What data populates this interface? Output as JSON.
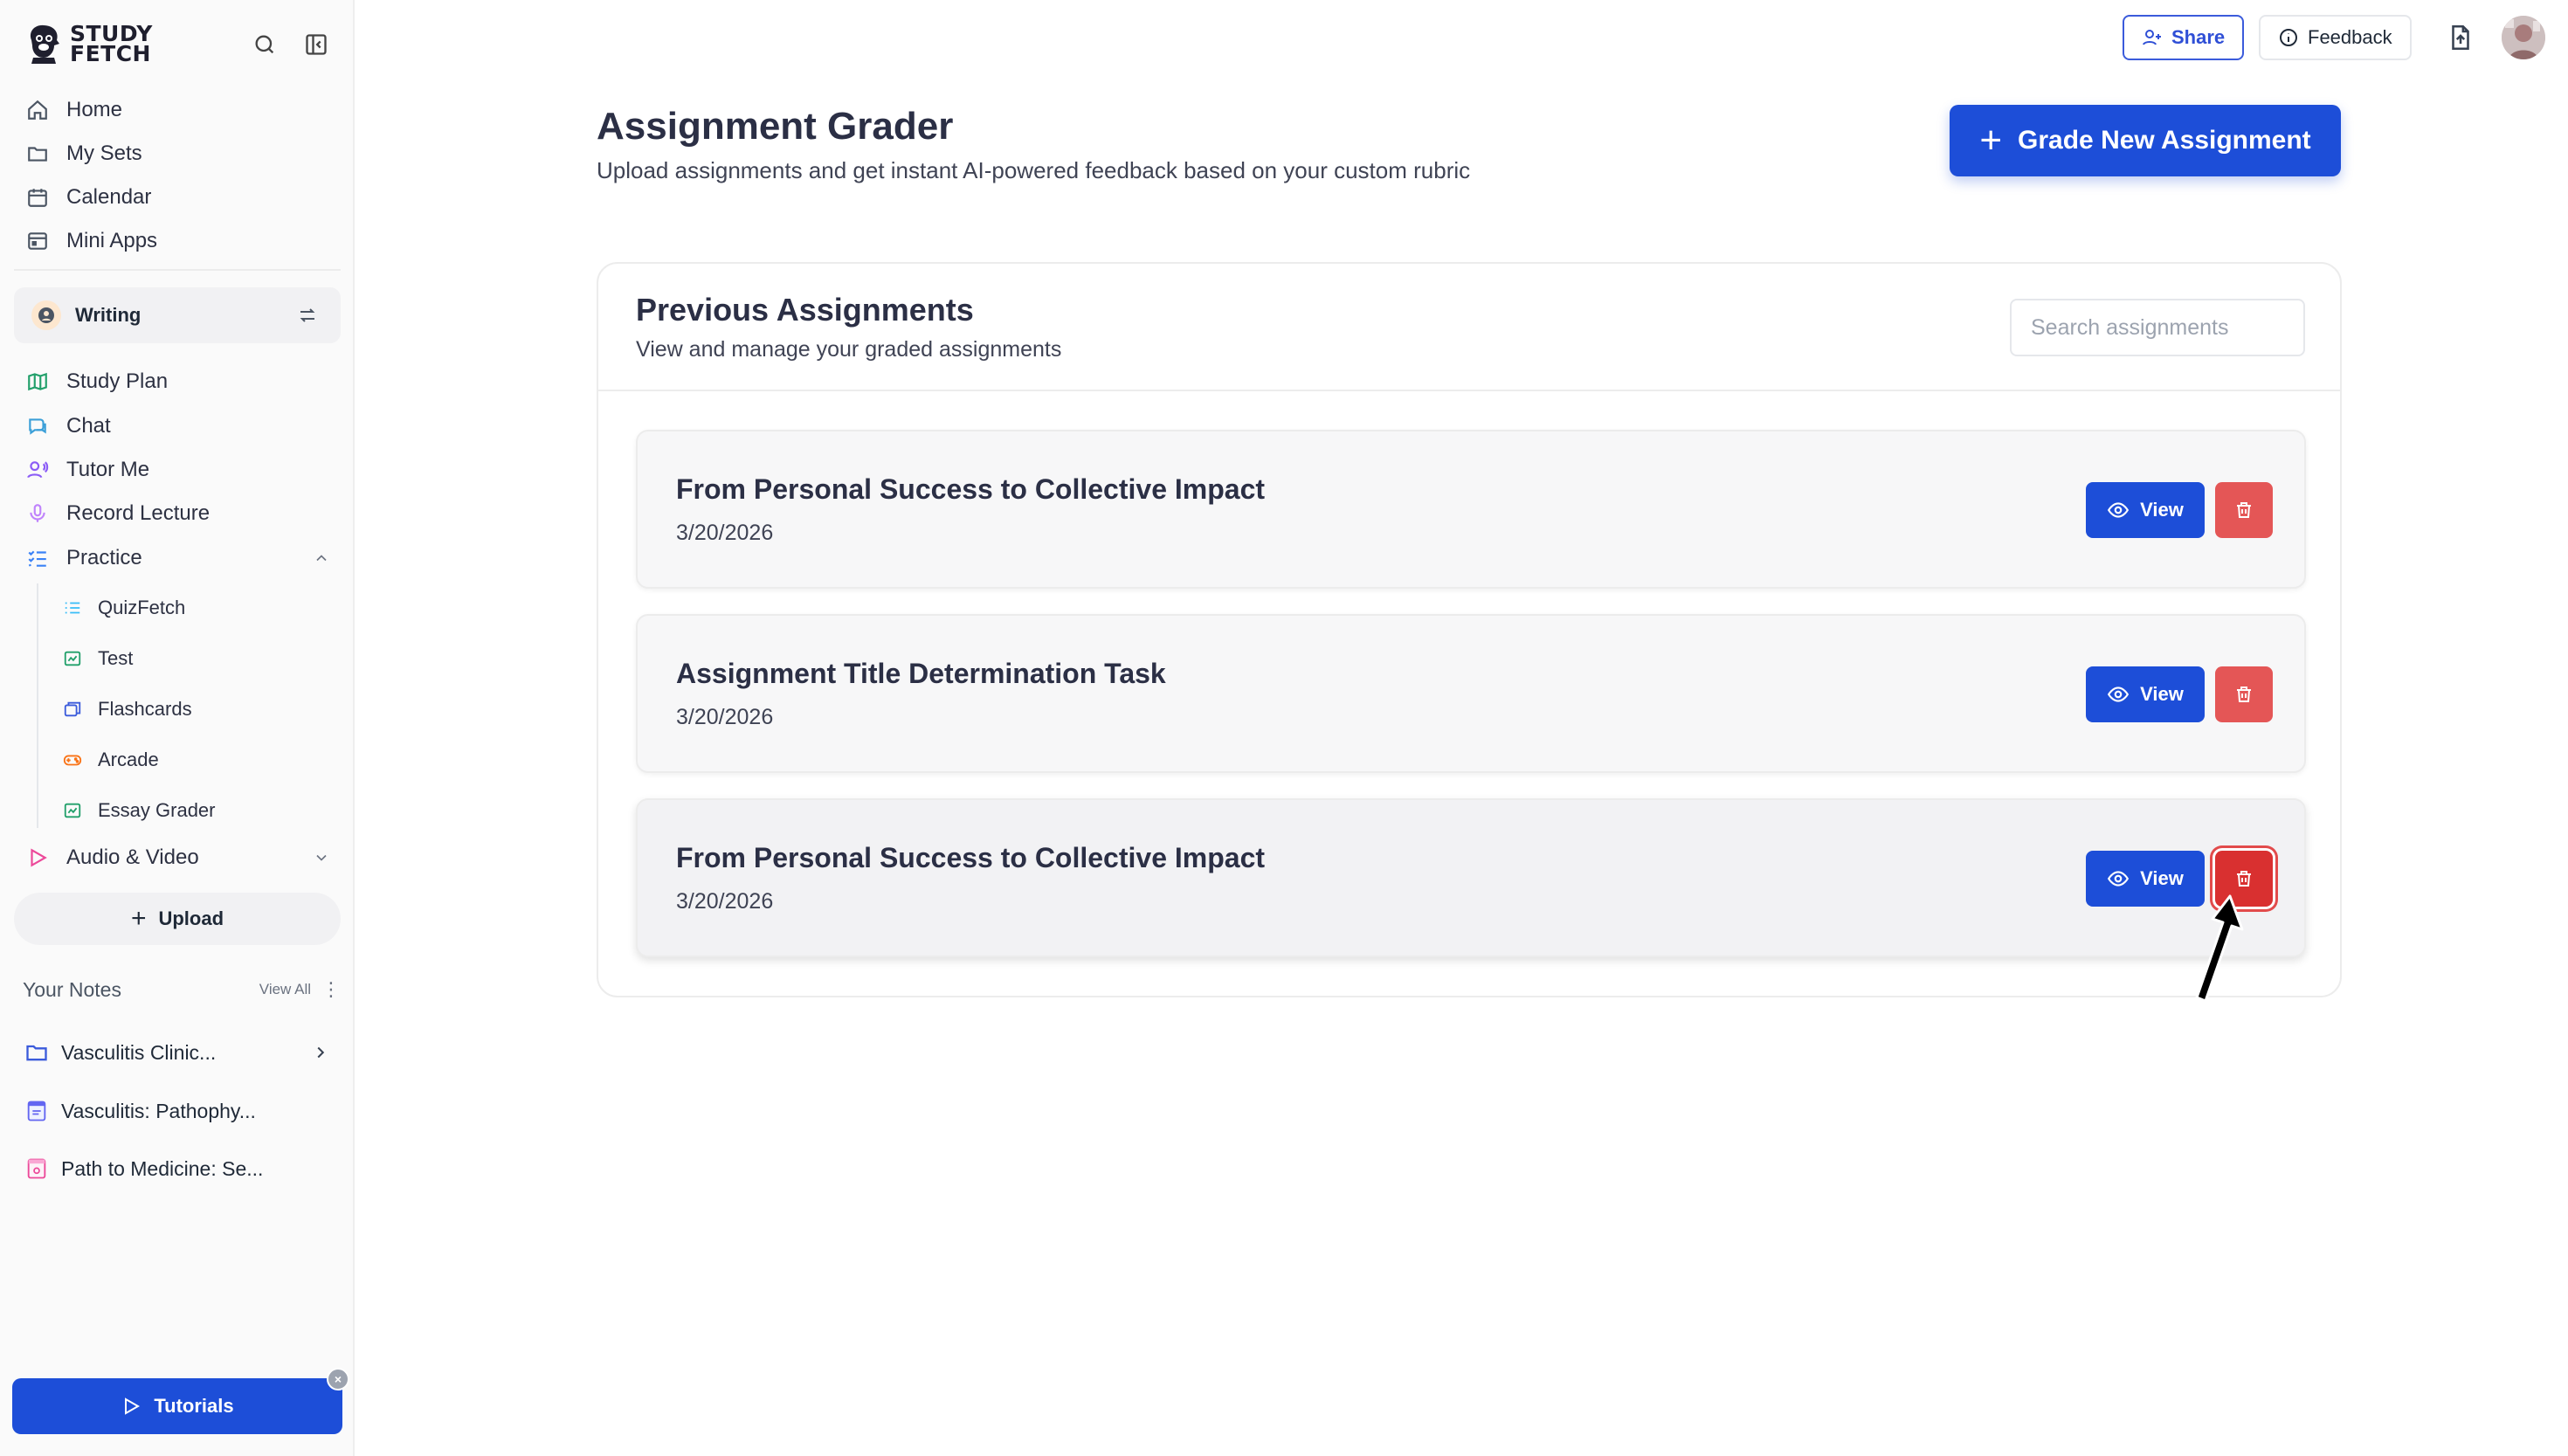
{
  "app": {
    "logo_line1": "STUDY",
    "logo_line2": "FETCH"
  },
  "sidebar": {
    "nav": [
      {
        "label": "Home",
        "icon": "home-icon"
      },
      {
        "label": "My Sets",
        "icon": "folder-icon"
      },
      {
        "label": "Calendar",
        "icon": "calendar-icon"
      },
      {
        "label": "Mini Apps",
        "icon": "app-window-icon"
      }
    ],
    "workspace": {
      "label": "Writing"
    },
    "tools": [
      {
        "label": "Study Plan",
        "icon": "map-icon"
      },
      {
        "label": "Chat",
        "icon": "chat-icon"
      },
      {
        "label": "Tutor Me",
        "icon": "tutor-icon"
      },
      {
        "label": "Record Lecture",
        "icon": "microphone-icon"
      },
      {
        "label": "Practice",
        "icon": "list-check-icon"
      }
    ],
    "practice_items": [
      {
        "label": "QuizFetch"
      },
      {
        "label": "Test"
      },
      {
        "label": "Flashcards"
      },
      {
        "label": "Arcade"
      },
      {
        "label": "Essay Grader"
      }
    ],
    "audio_video": {
      "label": "Audio & Video"
    },
    "upload_label": "Upload",
    "notes": {
      "title": "Your Notes",
      "view_all": "View All",
      "items": [
        {
          "label": "Vasculitis Clinic...",
          "icon": "folder-icon"
        },
        {
          "label": "Vasculitis: Pathophy...",
          "icon": "note-icon"
        },
        {
          "label": "Path to Medicine: Se...",
          "icon": "note-icon"
        }
      ]
    },
    "tutorials_label": "Tutorials"
  },
  "topbar": {
    "share_label": "Share",
    "feedback_label": "Feedback"
  },
  "main": {
    "title": "Assignment Grader",
    "subtitle": "Upload assignments and get instant AI-powered feedback based on your custom rubric",
    "grade_button": "Grade New Assignment",
    "panel": {
      "title": "Previous Assignments",
      "subtitle": "View and manage your graded assignments",
      "search_placeholder": "Search assignments",
      "assignments": [
        {
          "title": "From Personal Success to Collective Impact",
          "date": "3/20/2026",
          "view_label": "View"
        },
        {
          "title": "Assignment Title Determination Task",
          "date": "3/20/2026",
          "view_label": "View"
        },
        {
          "title": "From Personal Success to Collective Impact",
          "date": "3/20/2026",
          "view_label": "View"
        }
      ]
    }
  },
  "colors": {
    "primary": "#1d4ed8",
    "danger": "#e45656",
    "danger_active": "#d93030"
  }
}
